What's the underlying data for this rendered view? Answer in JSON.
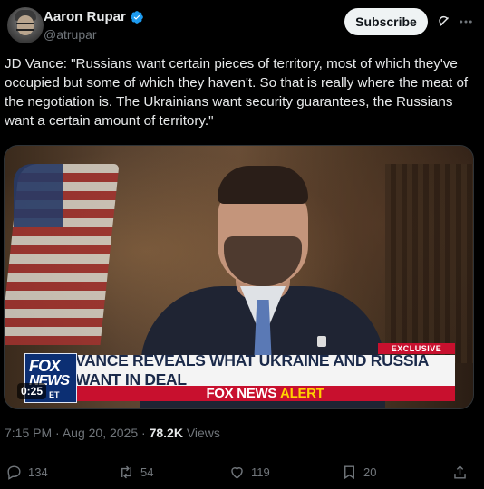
{
  "author": {
    "name": "Aaron Rupar",
    "handle": "@atrupar",
    "verified": true
  },
  "subscribe_label": "Subscribe",
  "icons": {
    "grok": "grok-icon",
    "more": "more-icon",
    "verified": "verified-badge-icon"
  },
  "tweet": {
    "text": "JD Vance: \"Russians want certain pieces of territory, most of which they've occupied but some of which they haven't. So that is really where the meat of the negotiation is. The Ukrainians want security guarantees, the Russians want a certain amount of territory.\""
  },
  "video": {
    "duration": "0:25",
    "exclusive_label": "EXCLUSIVE",
    "headline": "VANCE REVEALS WHAT UKRAINE AND RUSSIA WANT IN DEAL",
    "alert_prefix": "FOX NEWS",
    "alert_word": "ALERT",
    "logo_line1": "FOX",
    "logo_line2": "NEWS",
    "logo_et": "ET"
  },
  "meta": {
    "time": "7:15 PM",
    "separator": "·",
    "date": "Aug 20, 2025",
    "views_count": "78.2K",
    "views_label": "Views"
  },
  "actions": {
    "replies": "134",
    "reposts": "54",
    "likes": "119",
    "bookmarks": "20"
  },
  "colors": {
    "background": "#000000",
    "text": "#e7e9ea",
    "secondary": "#71767b",
    "verified": "#1d9bf0",
    "fox_red": "#c8102e",
    "fox_blue": "#0c2f73"
  }
}
